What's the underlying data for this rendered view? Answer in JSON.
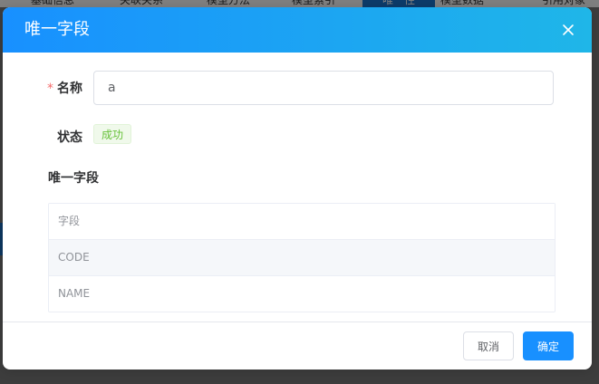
{
  "background": {
    "tabs": [
      {
        "label": "基础信息"
      },
      {
        "label": "关联关系"
      },
      {
        "label": "模型方法"
      },
      {
        "label": "模型索引"
      },
      {
        "label": "唯一性"
      },
      {
        "label": "模型数据"
      },
      {
        "label": "引用对象"
      }
    ]
  },
  "dialog": {
    "title": "唯一字段",
    "close_icon": "close-icon"
  },
  "form": {
    "name_label": "名称",
    "required_mark": "*",
    "name_value": "a",
    "status_label": "状态",
    "status_value": "成功"
  },
  "unique_fields": {
    "section_title": "唯一字段",
    "column_header": "字段",
    "rows": [
      "CODE",
      "NAME"
    ]
  },
  "footer": {
    "cancel_label": "取消",
    "confirm_label": "确定"
  },
  "colors": {
    "header_gradient_start": "#1890ff",
    "header_gradient_end": "#1fb6e8",
    "primary": "#1890ff",
    "success": "#67c23a",
    "required": "#f56c6c"
  }
}
